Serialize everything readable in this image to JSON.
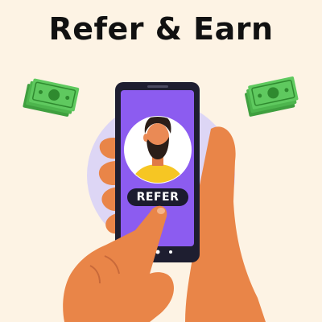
{
  "header": {
    "title": "Refer & Earn"
  },
  "phone": {
    "refer_button_label": "REFER"
  },
  "colors": {
    "background": "#fdf3e4",
    "phone_screen": "#8c5cf0",
    "phone_frame": "#1e1e30",
    "halo": "#ddd6f5",
    "skin": "#e98548",
    "money": "#5fc95f",
    "shirt": "#f6c623"
  },
  "icons": [
    "money-left-icon",
    "money-right-icon",
    "avatar-icon"
  ]
}
